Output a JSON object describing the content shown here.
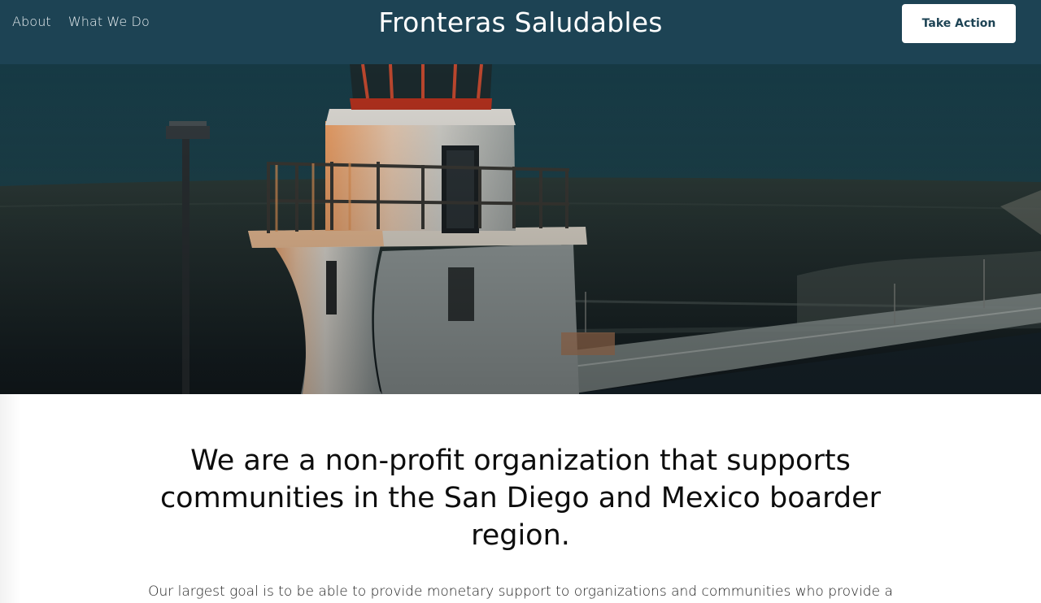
{
  "header": {
    "nav": [
      {
        "label": "About"
      },
      {
        "label": "What We Do"
      }
    ],
    "brand": "Fronteras Saludables",
    "cta_label": "Take Action",
    "background": "#1d4354"
  },
  "hero": {
    "image_subject": "lighthouse-at-border-fence",
    "colors": {
      "sky": "#123640",
      "tower": "#dcdad3",
      "sunlit": "#f0a060"
    }
  },
  "mission": {
    "heading": "We are a non-profit organization that supports communities in the San Diego and Mexico boarder region.",
    "body": "Our largest goal is to be able to provide monetary support to organizations and communities who provide a"
  }
}
